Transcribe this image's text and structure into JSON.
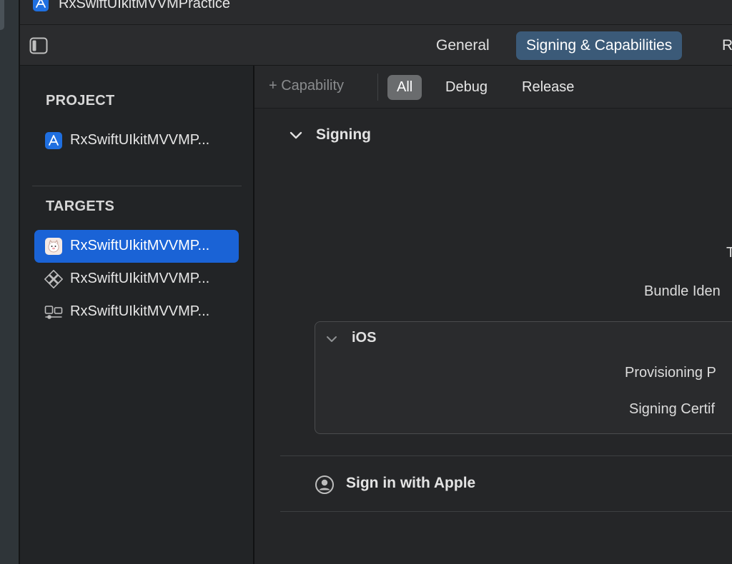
{
  "window": {
    "title": "RxSwiftUIkitMVVMPractice"
  },
  "tabs": [
    {
      "label": "General"
    },
    {
      "label": "Signing & Capabilities"
    },
    {
      "label": "R"
    }
  ],
  "sidebar": {
    "project_heading": "PROJECT",
    "project_items": [
      {
        "label": "RxSwiftUIkitMVVMP...",
        "icon": "app-store-icon"
      }
    ],
    "targets_heading": "TARGETS",
    "target_items": [
      {
        "label": "RxSwiftUIkitMVVMP...",
        "icon": "app-target-icon",
        "selected": true
      },
      {
        "label": "RxSwiftUIkitMVVMP...",
        "icon": "test-diamond-icon"
      },
      {
        "label": "RxSwiftUIkitMVVMP...",
        "icon": "ui-test-icon"
      }
    ]
  },
  "toolbar": {
    "add_capability": "+ Capability",
    "filters": [
      {
        "label": "All",
        "selected": true
      },
      {
        "label": "Debug"
      },
      {
        "label": "Release"
      }
    ]
  },
  "signing": {
    "title": "Signing",
    "team_label": "T",
    "bundle_label": "Bundle Iden",
    "ios": {
      "title": "iOS",
      "provisioning_label": "Provisioning P",
      "certificate_label": "Signing Certif"
    }
  },
  "apple_signin": {
    "title": "Sign in with Apple"
  },
  "colors": {
    "accent": "#1a63d6",
    "tab_selected": "#3b5a78",
    "background": "#252628"
  }
}
